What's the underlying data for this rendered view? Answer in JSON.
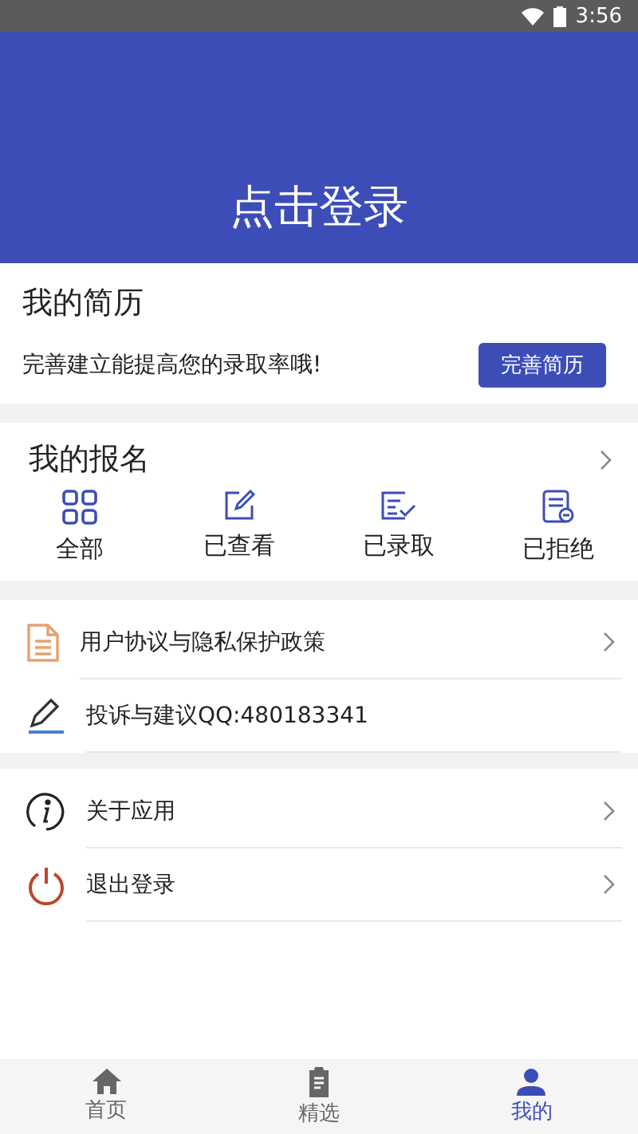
{
  "status_bar": {
    "time": "3:56"
  },
  "header": {
    "login": "点击登录"
  },
  "resume": {
    "title": "我的简历",
    "hint": "完善建立能提高您的录取率哦!",
    "button": "完善简历"
  },
  "signup": {
    "title": "我的报名",
    "filters": [
      {
        "label": "全部",
        "kind": "grid"
      },
      {
        "label": "已查看",
        "kind": "edit"
      },
      {
        "label": "已录取",
        "kind": "accepted"
      },
      {
        "label": "已拒绝",
        "kind": "rejected"
      }
    ]
  },
  "menu_groups": [
    {
      "items": [
        {
          "label": "用户协议与隐私保护政策",
          "kind": "document",
          "chevron": true
        },
        {
          "label": "投诉与建议QQ:480183341",
          "kind": "pencil",
          "chevron": false
        }
      ]
    },
    {
      "items": [
        {
          "label": "关于应用",
          "kind": "info",
          "chevron": true
        },
        {
          "label": "退出登录",
          "kind": "power",
          "chevron": true
        }
      ]
    }
  ],
  "tab_bar": [
    {
      "label": "首页",
      "kind": "home",
      "selected": false
    },
    {
      "label": "精选",
      "kind": "clipboard",
      "selected": false
    },
    {
      "label": "我的",
      "kind": "person",
      "selected": true
    }
  ]
}
